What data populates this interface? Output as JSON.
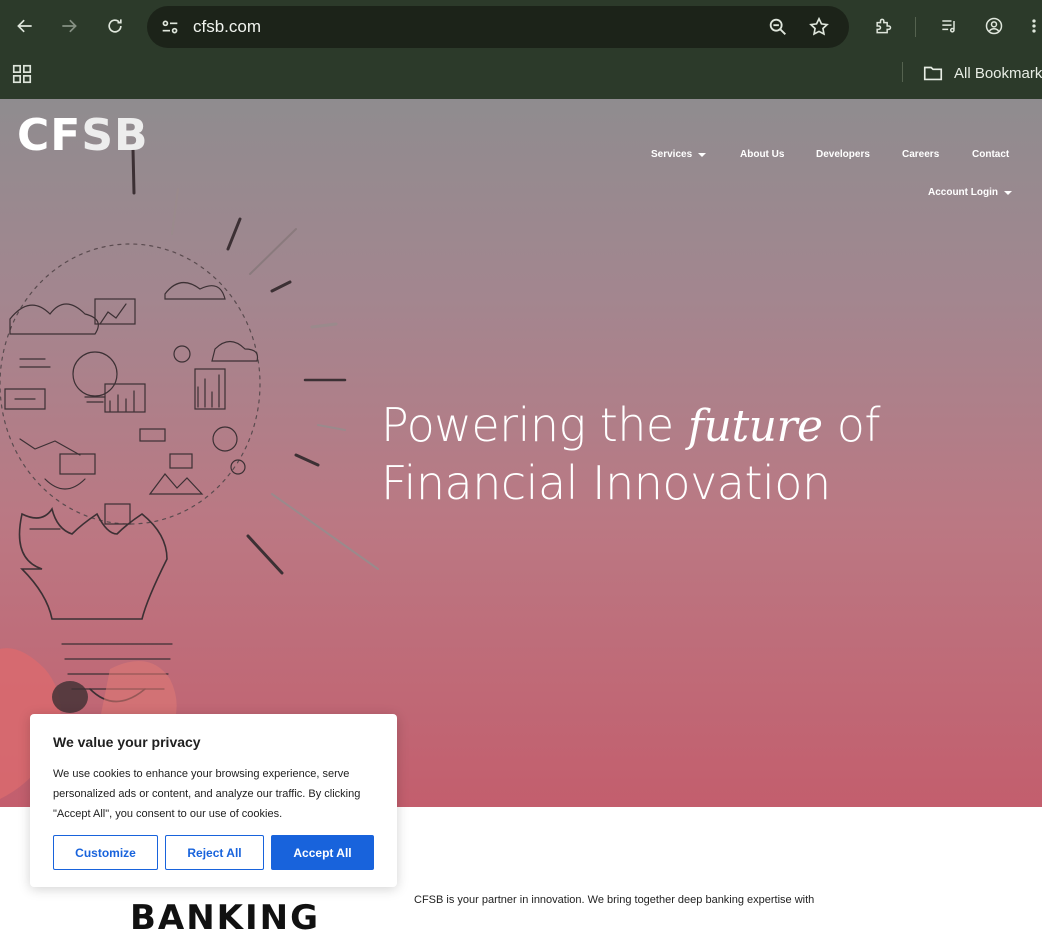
{
  "browser": {
    "url": "cfsb.com",
    "bookmarks_label": "All Bookmarks",
    "icons": [
      "back-icon",
      "forward-icon",
      "reload-icon",
      "site-settings-icon",
      "zoom-icon",
      "star-icon",
      "extensions-icon",
      "media-icon",
      "profile-icon",
      "menu-icon",
      "apps-icon",
      "folder-icon"
    ]
  },
  "site": {
    "logo": {
      "part1": "CF",
      "part2": "SB"
    },
    "nav": {
      "services": "Services",
      "about": "About Us",
      "developers": "Developers",
      "careers": "Careers",
      "contact": "Contact",
      "account_login": "Account Login"
    },
    "hero": {
      "line1_before": "Powering the ",
      "line1_em": "future",
      "line1_after": " of",
      "line2": "Financial Innovation"
    },
    "section_heading": "BANKING",
    "intro_text": "CFSB is your partner in innovation. We bring together deep banking expertise with"
  },
  "cookie": {
    "title": "We value your privacy",
    "text": "We use cookies to enhance your browsing experience, serve personalized ads or content, and analyze our traffic. By clicking \"Accept All\", you consent to our use of cookies.",
    "customize": "Customize",
    "reject": "Reject All",
    "accept": "Accept All"
  },
  "colors": {
    "chrome_bg": "#2c3a2a",
    "accent_blue": "#1863dc",
    "hero_top": "#8f8c8f",
    "hero_bottom": "#c35e6d"
  }
}
